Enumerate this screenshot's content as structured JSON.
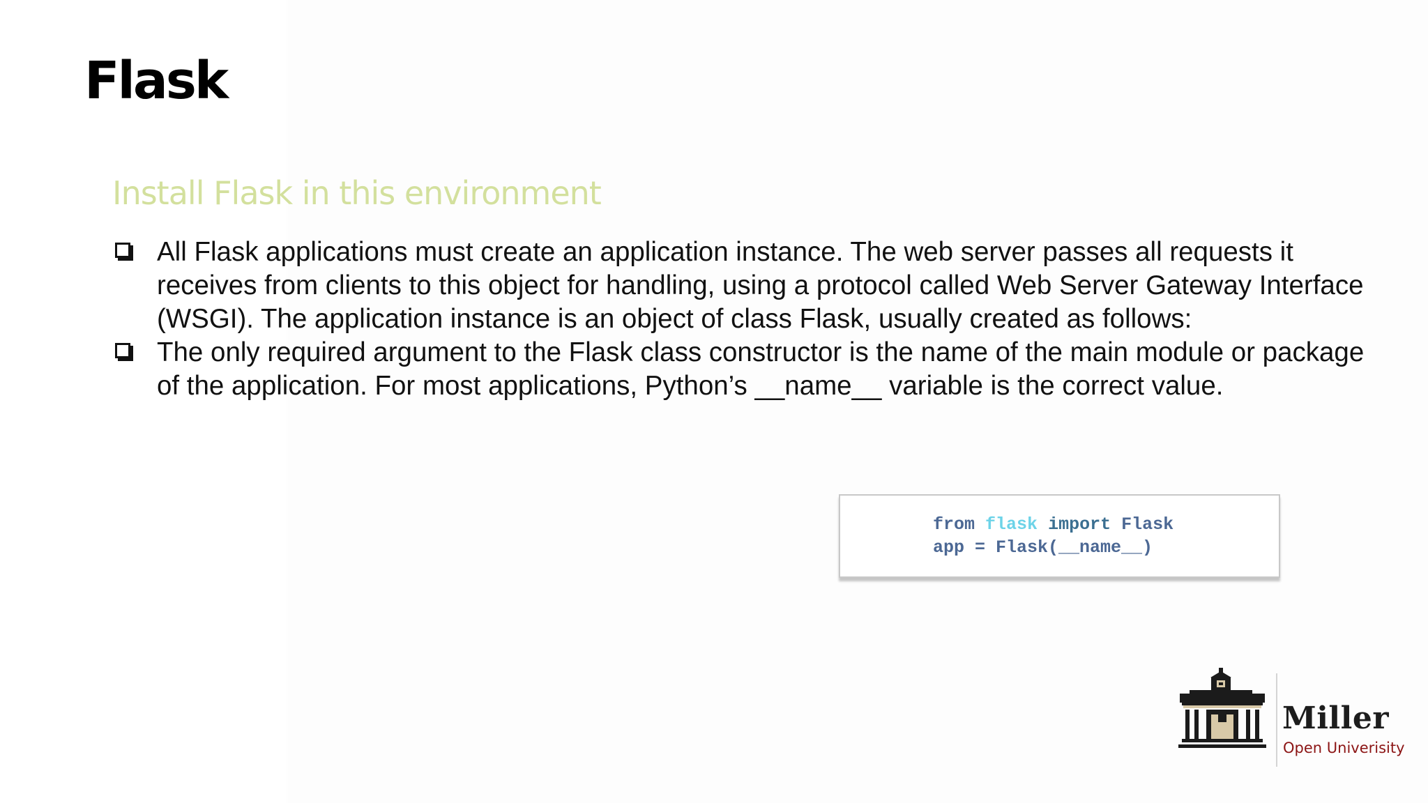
{
  "slide": {
    "title": "Flask",
    "subtitle": "Install Flask in this environment",
    "bullets": [
      "All Flask applications must create an application instance. The web server passes all requests it receives from clients to this object for handling, using a protocol called Web Server Gateway Interface (WSGI). The application instance is an object of class Flask, usually created as follows:",
      "The only required argument to the Flask class constructor is the name of the main module or package of the application. For most applications, Python’s __name__ variable is the correct value."
    ]
  },
  "code": {
    "line1": {
      "from": "from",
      "module": "flask",
      "import": "import",
      "class_name": "Flask"
    },
    "line2": {
      "text": "app = Flask(__name__)"
    }
  },
  "branding": {
    "name": "Miller",
    "tagline": "Open Univerisity",
    "icon": "university-building-icon"
  },
  "colors": {
    "subtitle": "#d3e09d",
    "code_text": "#4c6894",
    "code_flask": "#6dd3e8",
    "brand_tagline": "#8c1515"
  }
}
